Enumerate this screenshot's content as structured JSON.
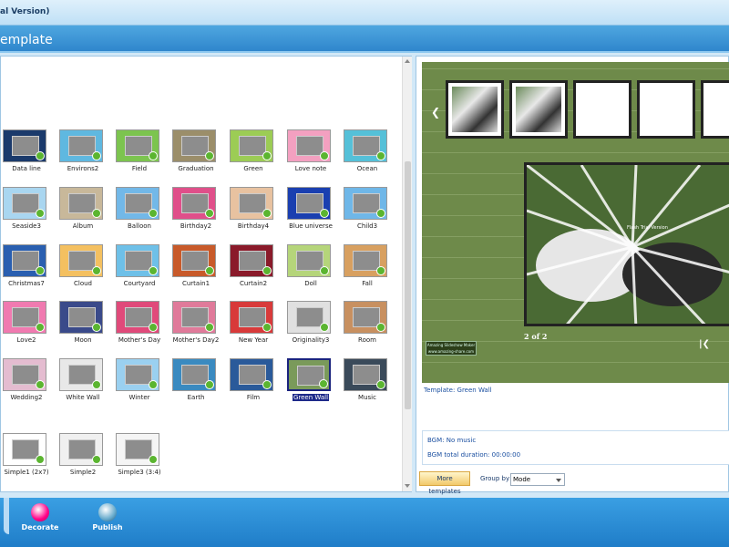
{
  "window": {
    "title": "al Version)",
    "header": "emplate"
  },
  "templates": [
    {
      "label": "Data line",
      "bg": "#1b3a6b"
    },
    {
      "label": "Environs2",
      "bg": "#5fb8e0"
    },
    {
      "label": "Field",
      "bg": "#7cc44f"
    },
    {
      "label": "Graduation",
      "bg": "#9b8e6a"
    },
    {
      "label": "Green",
      "bg": "#9ccc55"
    },
    {
      "label": "Love note",
      "bg": "#f3a0c0"
    },
    {
      "label": "Ocean",
      "bg": "#55c0d8"
    },
    {
      "label": "Seaside3",
      "bg": "#a9d6f0"
    },
    {
      "label": "Album",
      "bg": "#c8b89a"
    },
    {
      "label": "Balloon",
      "bg": "#72b8e8"
    },
    {
      "label": "Birthday2",
      "bg": "#e04f8a"
    },
    {
      "label": "Birthday4",
      "bg": "#e8c2a0"
    },
    {
      "label": "Blue universe",
      "bg": "#1a3fb0"
    },
    {
      "label": "Child3",
      "bg": "#6fb7e8"
    },
    {
      "label": "Christmas7",
      "bg": "#2a5fb0"
    },
    {
      "label": "Cloud",
      "bg": "#f4c060"
    },
    {
      "label": "Courtyard",
      "bg": "#6ec0e8"
    },
    {
      "label": "Curtain1",
      "bg": "#c85a2a"
    },
    {
      "label": "Curtain2",
      "bg": "#8a1a2a"
    },
    {
      "label": "Doll",
      "bg": "#b5d57a"
    },
    {
      "label": "Fall",
      "bg": "#d8a060"
    },
    {
      "label": "Love2",
      "bg": "#f07ab0"
    },
    {
      "label": "Moon",
      "bg": "#3a4a8a"
    },
    {
      "label": "Mother's Day",
      "bg": "#e04a7a"
    },
    {
      "label": "Mother's Day2",
      "bg": "#e07a9a"
    },
    {
      "label": "New Year",
      "bg": "#d83a3a"
    },
    {
      "label": "Originality3",
      "bg": "#e0e0e0"
    },
    {
      "label": "Room",
      "bg": "#c89060"
    },
    {
      "label": "Wedding2",
      "bg": "#e4bcd0"
    },
    {
      "label": "White Wall",
      "bg": "#e8e8e8"
    },
    {
      "label": "Winter",
      "bg": "#9ad0f0"
    },
    {
      "label": "Earth",
      "bg": "#3a8ac0"
    },
    {
      "label": "Film",
      "bg": "#2a5a9a"
    },
    {
      "label": "Green Wall",
      "bg": "#7a9a5a",
      "selected": true
    },
    {
      "label": "Music",
      "bg": "#3a4a5a"
    },
    {
      "label": "Simple1 (2x7)",
      "bg": "#ffffff"
    },
    {
      "label": "Simple2",
      "bg": "#f0f0f0"
    },
    {
      "label": "Simple3 (3:4)",
      "bg": "#f5f5f5"
    }
  ],
  "preview": {
    "counter": "2 of 2",
    "watermark": "Flash Trial Version",
    "logo_line1": "Amazing Slideshow Maker",
    "logo_line2": "www.amazing-share.com"
  },
  "info": {
    "template": "Template:  Green Wall",
    "bgm": "BGM: No music",
    "bgm_duration": "BGM total duration: 00:00:00"
  },
  "controls": {
    "more_templates": "More templates",
    "group_by": "Group by",
    "mode": "Mode"
  },
  "toolbar": {
    "decorate": "Decorate",
    "publish": "Publish"
  }
}
